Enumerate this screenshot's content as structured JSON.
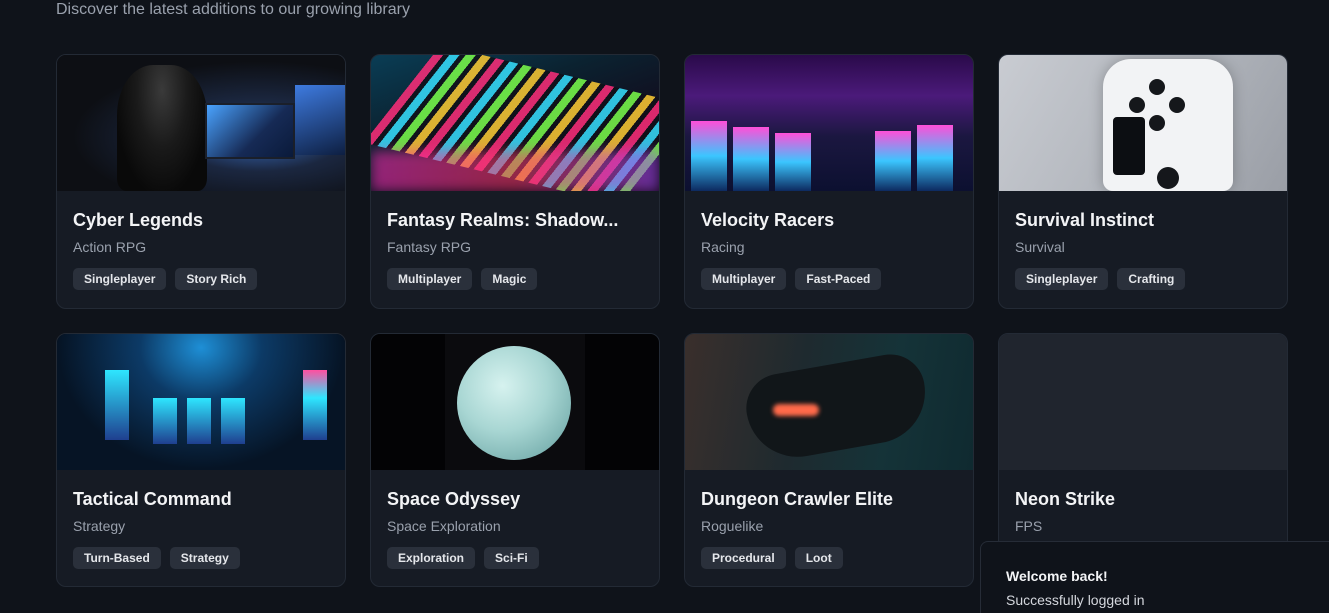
{
  "header": {
    "subtitle": "Discover the latest additions to our growing library"
  },
  "games": [
    {
      "title": "Cyber Legends",
      "genre": "Action RPG",
      "tags": [
        "Singleplayer",
        "Story Rich"
      ],
      "thumbnail": "person-gaming-at-multi-monitor-setup"
    },
    {
      "title": "Fantasy Realms: Shadow...",
      "genre": "Fantasy RPG",
      "tags": [
        "Multiplayer",
        "Magic"
      ],
      "thumbnail": "rgb-mechanical-keyboard"
    },
    {
      "title": "Velocity Racers",
      "genre": "Racing",
      "tags": [
        "Multiplayer",
        "Fast-Paced"
      ],
      "thumbnail": "neon-arcade-room"
    },
    {
      "title": "Survival Instinct",
      "genre": "Survival",
      "tags": [
        "Singleplayer",
        "Crafting"
      ],
      "thumbnail": "white-game-controller"
    },
    {
      "title": "Tactical Command",
      "genre": "Strategy",
      "tags": [
        "Turn-Based",
        "Strategy"
      ],
      "thumbnail": "blue-lit-arcade-machines"
    },
    {
      "title": "Space Odyssey",
      "genre": "Space Exploration",
      "tags": [
        "Exploration",
        "Sci-Fi"
      ],
      "thumbnail": "pale-planet"
    },
    {
      "title": "Dungeon Crawler Elite",
      "genre": "Roguelike",
      "tags": [
        "Procedural",
        "Loot"
      ],
      "thumbnail": "dark-controller-with-orange-light"
    },
    {
      "title": "Neon Strike",
      "genre": "FPS",
      "tags": [],
      "thumbnail": "empty-placeholder"
    }
  ],
  "toast": {
    "title": "Welcome back!",
    "message": "Successfully logged in"
  }
}
